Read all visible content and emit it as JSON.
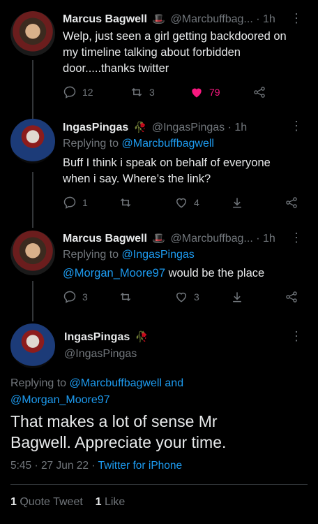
{
  "tweets": [
    {
      "name": "Marcus Bagwell",
      "emoji": "🎩",
      "handle": "@Marcbuffbag...",
      "time": "· 1h",
      "lines": [
        "Welp, just seen a girl getting backdoored on",
        "my timeline talking about forbidden",
        "door.....thanks twitter"
      ],
      "replies": "12",
      "retweets": "3",
      "likes": "79"
    },
    {
      "name": "IngasPingas",
      "emoji": "🥀",
      "handle": "@IngasPingas",
      "time": "· 1h",
      "replying_prefix": "Replying to",
      "replying_to": "@Marcbuffbagwell",
      "lines": [
        "Buff I think i speak on behalf of everyone",
        "when i say. Where’s the link?"
      ],
      "replies": "1",
      "retweets": "",
      "likes": "4"
    },
    {
      "name": "Marcus Bagwell",
      "emoji": "🎩",
      "handle": "@Marcbuffbag...",
      "time": "· 1h",
      "replying_prefix": "Replying to",
      "replying_to": "@IngasPingas",
      "mention": "@Morgan_Moore97",
      "text_rest": " would be the place",
      "replies": "3",
      "retweets": "",
      "likes": "3"
    }
  ],
  "main": {
    "name": "IngasPingas",
    "emoji": "🥀",
    "handle": "@IngasPingas",
    "replying_prefix": "Replying to",
    "replying_to_1": "@Marcbuffbagwell",
    "and": " and",
    "replying_to_2": "@Morgan_Moore97",
    "line1": "That makes a lot of sense Mr",
    "line2": "Bagwell. Appreciate your time.",
    "time": "5:45 · 27 Jun 22 ·",
    "source": "Twitter for iPhone",
    "quote_count": "1",
    "quote_label": "Quote Tweet",
    "like_count": "1",
    "like_label": "Like"
  },
  "more_glyph": "⋮",
  "colors": {
    "accent": "#1d9bf0",
    "like": "#f91880",
    "muted": "#71767b",
    "bg": "#000000"
  }
}
